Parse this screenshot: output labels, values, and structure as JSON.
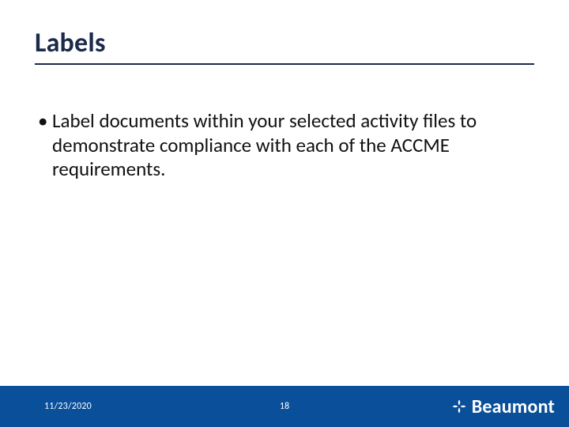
{
  "title": "Labels",
  "bullets": [
    "Label documents within your selected activity files to demonstrate compliance with each of the ACCME requirements."
  ],
  "footer": {
    "date": "11/23/2020",
    "page": "18",
    "brand": "Beaumont"
  },
  "colors": {
    "heading": "#1c2a4a",
    "footer_bg": "#0a4f9a",
    "footer_text": "#ffffff"
  }
}
